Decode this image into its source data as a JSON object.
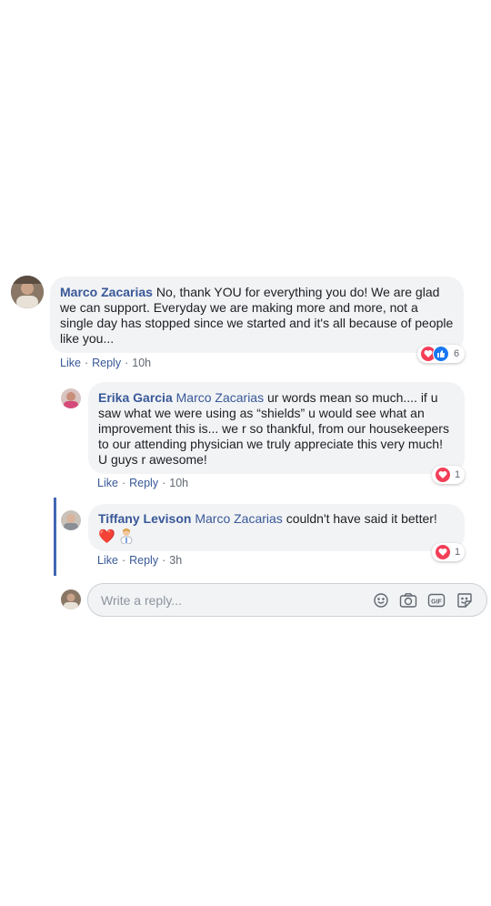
{
  "comment": {
    "author": "Marco Zacarias",
    "text": "No, thank YOU for everything you do! We are glad we can support. Everyday we are making more and more, not a single day has stopped since we started and it's all because of people like you...",
    "actions": {
      "like": "Like",
      "reply": "Reply",
      "time": "10h"
    },
    "reaction_count": "6"
  },
  "replies": [
    {
      "author": "Erika Garcia",
      "mention": "Marco Zacarias",
      "text": "ur words mean so much.... if u saw what we were using as “shields” u would see what an improvement this is... we r so thankful, from our housekeepers to our attending physician we truly appreciate this very much! U guys r awesome!",
      "actions": {
        "like": "Like",
        "reply": "Reply",
        "time": "10h"
      },
      "reaction_count": "1"
    },
    {
      "author": "Tiffany Levison",
      "mention": "Marco Zacarias",
      "text": "couldn't have said it better!",
      "emoji": "❤️",
      "actions": {
        "like": "Like",
        "reply": "Reply",
        "time": "3h"
      },
      "reaction_count": "1"
    }
  ],
  "reply_box": {
    "placeholder": "Write a reply...",
    "tools": [
      "emoji-icon",
      "camera-icon",
      "gif-icon",
      "sticker-icon"
    ],
    "gif_label": "GIF"
  },
  "colors": {
    "link": "#385898",
    "bubble": "#f2f3f5",
    "love": "#f33e58",
    "like": "#1877f2",
    "thread_line": "#4267b2"
  }
}
